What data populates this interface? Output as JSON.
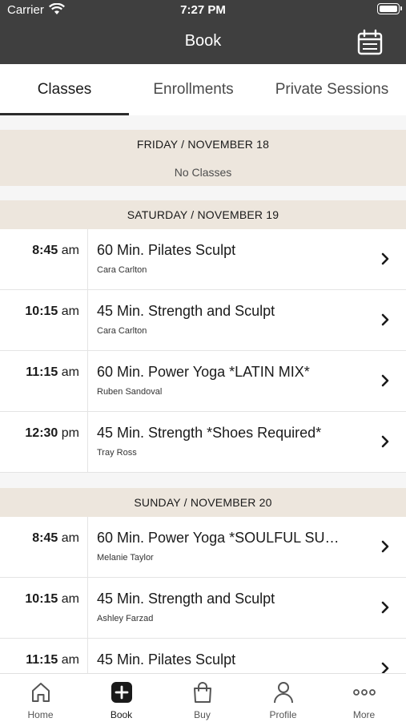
{
  "status_bar": {
    "carrier": "Carrier",
    "time": "7:27 PM"
  },
  "header": {
    "title": "Book"
  },
  "tabs": [
    {
      "label": "Classes"
    },
    {
      "label": "Enrollments"
    },
    {
      "label": "Private Sessions"
    }
  ],
  "days": [
    {
      "header": "FRIDAY / NOVEMBER 18",
      "empty_text": "No Classes",
      "classes": []
    },
    {
      "header": "SATURDAY / NOVEMBER 19",
      "classes": [
        {
          "time": "8:45",
          "ampm": "am",
          "title": "60 Min. Pilates Sculpt",
          "instructor": "Cara Carlton"
        },
        {
          "time": "10:15",
          "ampm": "am",
          "title": "45 Min. Strength and Sculpt",
          "instructor": "Cara Carlton"
        },
        {
          "time": "11:15",
          "ampm": "am",
          "title": "60 Min. Power Yoga *LATIN MIX*",
          "instructor": "Ruben Sandoval"
        },
        {
          "time": "12:30",
          "ampm": "pm",
          "title": "45 Min. Strength *Shoes Required*",
          "instructor": "Tray Ross"
        }
      ]
    },
    {
      "header": "SUNDAY / NOVEMBER 20",
      "classes": [
        {
          "time": "8:45",
          "ampm": "am",
          "title": "60 Min. Power Yoga *SOULFUL SU…",
          "instructor": "Melanie Taylor"
        },
        {
          "time": "10:15",
          "ampm": "am",
          "title": "45 Min. Strength and Sculpt",
          "instructor": "Ashley Farzad"
        },
        {
          "time": "11:15",
          "ampm": "am",
          "title": "45 Min. Pilates Sculpt",
          "instructor": ""
        }
      ]
    }
  ],
  "bottom_nav": [
    {
      "label": "Home",
      "icon": "home-icon"
    },
    {
      "label": "Book",
      "icon": "plus-square-icon"
    },
    {
      "label": "Buy",
      "icon": "shopping-bag-icon"
    },
    {
      "label": "Profile",
      "icon": "person-icon"
    },
    {
      "label": "More",
      "icon": "more-dots-icon"
    }
  ],
  "colors": {
    "header_bg": "#3f3f3f",
    "day_header_bg": "#ede6dd",
    "accent": "#2b2b2b"
  }
}
